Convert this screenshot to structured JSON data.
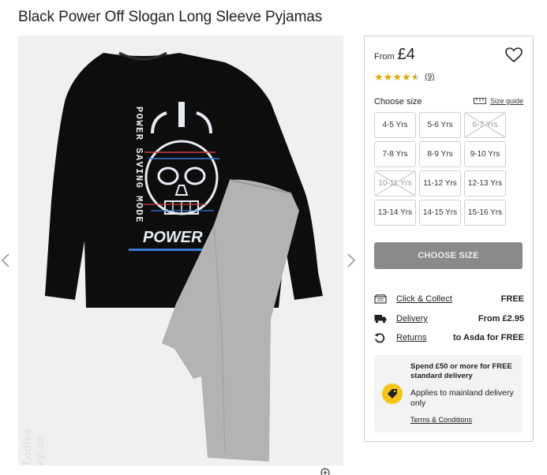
{
  "product": {
    "title": "Black Power Off Slogan Long Sleeve Pyjamas"
  },
  "gallery": {
    "image_alt": "black long sleeve top with glitch skull POWER SAVING MODE print and grey pyjama bottoms",
    "print_vertical_text": "POWER SAVING MODE",
    "print_bottom_text": "POWER",
    "watermark": "Ladies ep.us"
  },
  "price": {
    "from_label": "From",
    "amount": "£4"
  },
  "rating": {
    "stars": 4.5,
    "count_label": "(9)"
  },
  "sizes": {
    "label": "Choose size",
    "guide_label": "Size guide",
    "options": [
      {
        "label": "4-5 Yrs",
        "available": true
      },
      {
        "label": "5-6 Yrs",
        "available": true
      },
      {
        "label": "6-7 Yrs",
        "available": false
      },
      {
        "label": "7-8 Yrs",
        "available": true
      },
      {
        "label": "8-9 Yrs",
        "available": true
      },
      {
        "label": "9-10 Yrs",
        "available": true
      },
      {
        "label": "10-11 Yrs",
        "available": false
      },
      {
        "label": "11-12 Yrs",
        "available": true
      },
      {
        "label": "12-13 Yrs",
        "available": true
      },
      {
        "label": "13-14 Yrs",
        "available": true
      },
      {
        "label": "14-15 Yrs",
        "available": true
      },
      {
        "label": "15-16 Yrs",
        "available": true
      }
    ]
  },
  "cta": {
    "label": "CHOOSE SIZE"
  },
  "delivery": [
    {
      "icon": "store-icon",
      "label": "Click & Collect",
      "value": "FREE"
    },
    {
      "icon": "truck-icon",
      "label": "Delivery",
      "value": "From £2.95"
    },
    {
      "icon": "return-icon",
      "label": "Returns",
      "value": "to Asda for FREE"
    }
  ],
  "promo": {
    "headline": "Spend £50 or more for FREE standard delivery",
    "body": "Applies to mainland delivery only",
    "link": "Terms & Conditions"
  },
  "colors": {
    "star": "#e0a800",
    "cta_disabled": "#8a8a8a",
    "promo_badge": "#f5c518",
    "panel_border": "#cfcfcf"
  }
}
